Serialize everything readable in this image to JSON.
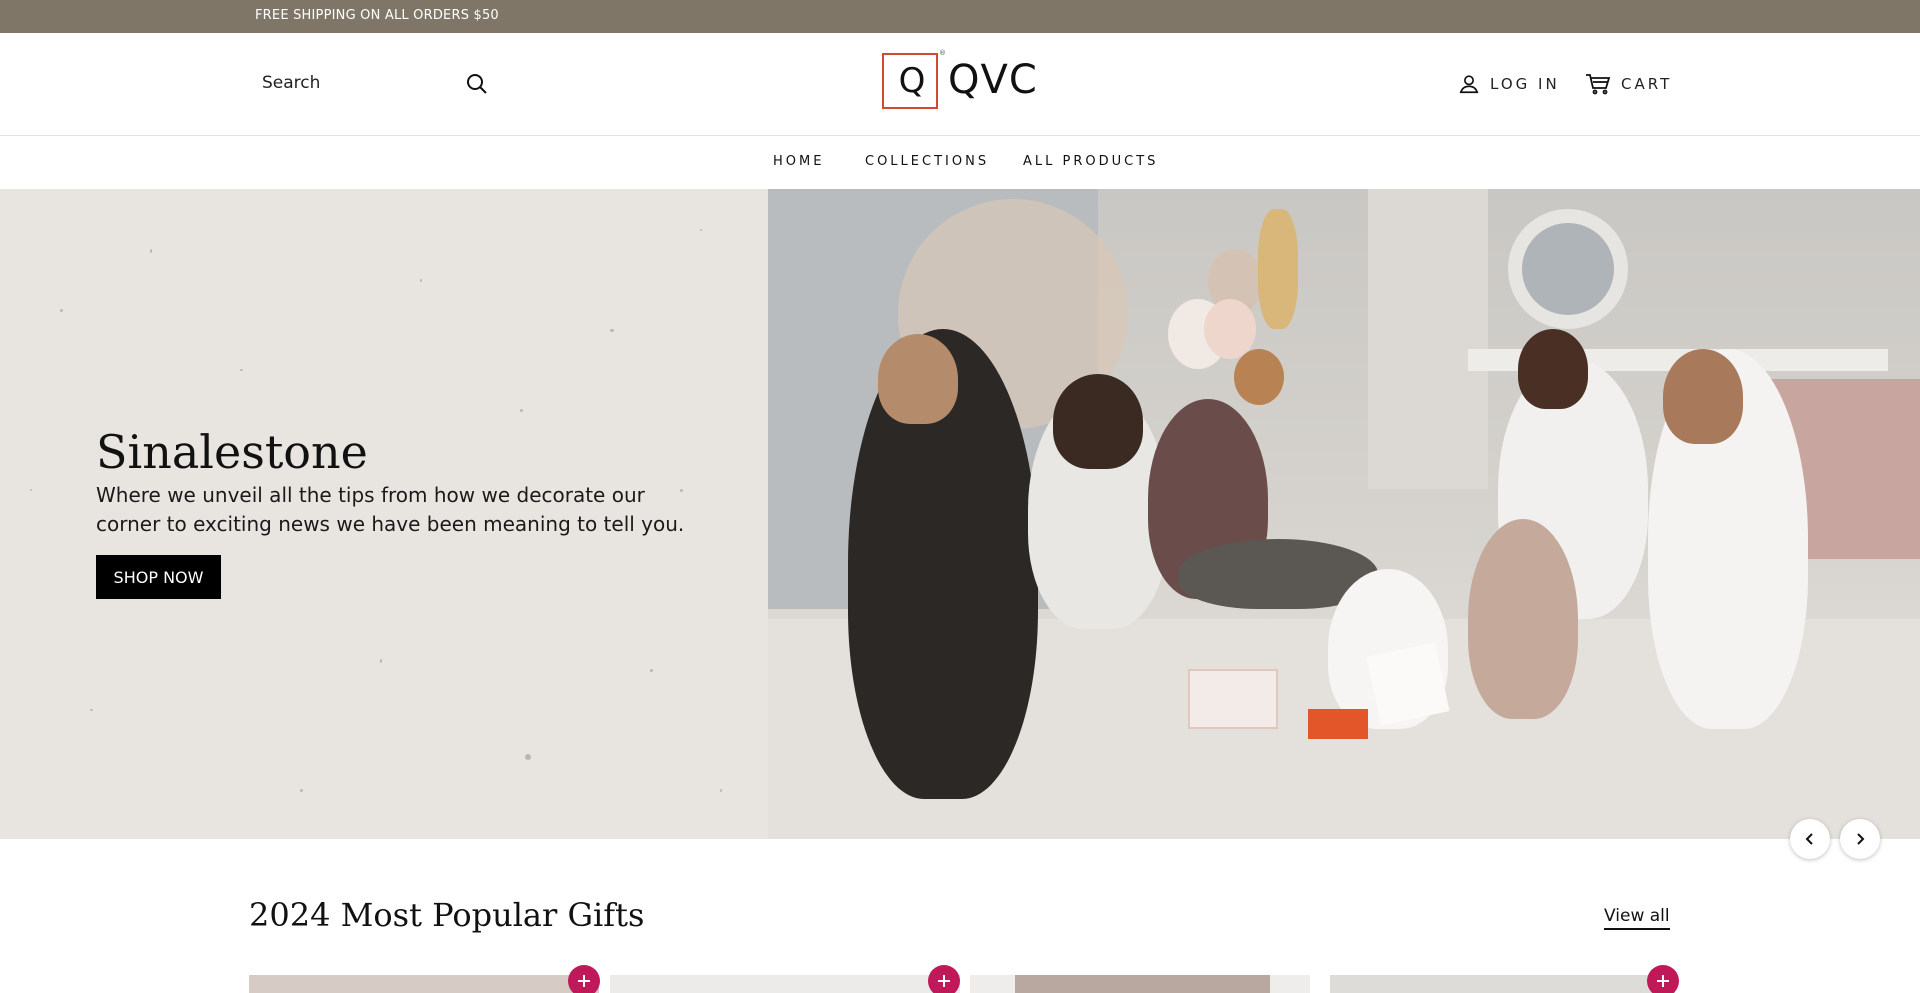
{
  "announcement": {
    "text": "FREE SHIPPING ON ALL ORDERS $50"
  },
  "header": {
    "search_placeholder": "Search",
    "logo": {
      "mark": "Q",
      "word": "QVC",
      "tm": "®"
    },
    "login_label": "LOG IN",
    "cart_label": "CART"
  },
  "nav": {
    "items": [
      {
        "label": "HOME"
      },
      {
        "label": "COLLECTIONS"
      },
      {
        "label": "ALL PRODUCTS"
      }
    ]
  },
  "hero": {
    "title": "Sinalestone",
    "subtitle_line1": "Where we unveil all the tips from how we decorate our",
    "subtitle_line2": "corner to exciting news we have been meaning to tell you.",
    "button_label": "SHOP NOW",
    "prev_icon": "chevron-left-icon",
    "next_icon": "chevron-right-icon"
  },
  "popular": {
    "title": "2024 Most Popular Gifts",
    "view_all_label": "View all"
  },
  "colors": {
    "announcement_bg": "#7f7667",
    "logo_accent": "#d04b32",
    "add_button": "#c0195a",
    "hero_left_bg": "#e8e5e1"
  }
}
